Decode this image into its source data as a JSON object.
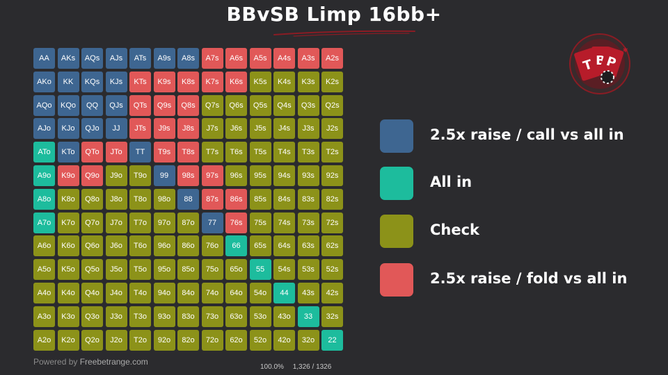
{
  "title": "BBvSB Limp 16bb+",
  "colors": {
    "raise_call": "#3e6691",
    "all_in": "#1dbc9d",
    "check": "#8c9219",
    "raise_fold": "#e15858",
    "background": "#2b2b2e",
    "accent": "#8a1c24"
  },
  "logo": {
    "text": "TBP"
  },
  "ranks": [
    "A",
    "K",
    "Q",
    "J",
    "T",
    "9",
    "8",
    "7",
    "6",
    "5",
    "4",
    "3",
    "2"
  ],
  "matrix": [
    [
      "AA",
      "AKs",
      "AQs",
      "AJs",
      "ATs",
      "A9s",
      "A8s",
      "A7s",
      "A6s",
      "A5s",
      "A4s",
      "A3s",
      "A2s"
    ],
    [
      "AKo",
      "KK",
      "KQs",
      "KJs",
      "KTs",
      "K9s",
      "K8s",
      "K7s",
      "K6s",
      "K5s",
      "K4s",
      "K3s",
      "K2s"
    ],
    [
      "AQo",
      "KQo",
      "QQ",
      "QJs",
      "QTs",
      "Q9s",
      "Q8s",
      "Q7s",
      "Q6s",
      "Q5s",
      "Q4s",
      "Q3s",
      "Q2s"
    ],
    [
      "AJo",
      "KJo",
      "QJo",
      "JJ",
      "JTs",
      "J9s",
      "J8s",
      "J7s",
      "J6s",
      "J5s",
      "J4s",
      "J3s",
      "J2s"
    ],
    [
      "ATo",
      "KTo",
      "QTo",
      "JTo",
      "TT",
      "T9s",
      "T8s",
      "T7s",
      "T6s",
      "T5s",
      "T4s",
      "T3s",
      "T2s"
    ],
    [
      "A9o",
      "K9o",
      "Q9o",
      "J9o",
      "T9o",
      "99",
      "98s",
      "97s",
      "96s",
      "95s",
      "94s",
      "93s",
      "92s"
    ],
    [
      "A8o",
      "K8o",
      "Q8o",
      "J8o",
      "T8o",
      "98o",
      "88",
      "87s",
      "86s",
      "85s",
      "84s",
      "83s",
      "82s"
    ],
    [
      "A7o",
      "K7o",
      "Q7o",
      "J7o",
      "T7o",
      "97o",
      "87o",
      "77",
      "76s",
      "75s",
      "74s",
      "73s",
      "72s"
    ],
    [
      "A6o",
      "K6o",
      "Q6o",
      "J6o",
      "T6o",
      "96o",
      "86o",
      "76o",
      "66",
      "65s",
      "64s",
      "63s",
      "62s"
    ],
    [
      "A5o",
      "K5o",
      "Q5o",
      "J5o",
      "T5o",
      "95o",
      "85o",
      "75o",
      "65o",
      "55",
      "54s",
      "53s",
      "52s"
    ],
    [
      "A4o",
      "K4o",
      "Q4o",
      "J4o",
      "T4o",
      "94o",
      "84o",
      "74o",
      "64o",
      "54o",
      "44",
      "43s",
      "42s"
    ],
    [
      "A3o",
      "K3o",
      "Q3o",
      "J3o",
      "T3o",
      "93o",
      "83o",
      "73o",
      "63o",
      "53o",
      "43o",
      "33",
      "32s"
    ],
    [
      "A2o",
      "K2o",
      "Q2o",
      "J2o",
      "T2o",
      "92o",
      "82o",
      "72o",
      "62o",
      "52o",
      "42o",
      "32o",
      "22"
    ]
  ],
  "actions": [
    "BBBBBBBRRRRRR",
    "BBBBRRRRRCCCC",
    "BBBBRRRCCCCCC",
    "BBBBRRRCCCCCC",
    "ABRRBRRCCCCCC",
    "ARRCCBRRCCCCC",
    "ACCCCCBRRCCCC",
    "ACCCCCCBRCCCC",
    "CCCCCCCCACCCC",
    "CCCCCCCCCACCC",
    "CCCCCCCCCCACC",
    "CCCCCCCCCCCAC",
    "CCCCCCCCCCCCA"
  ],
  "legend": [
    {
      "label": "2.5x raise / call vs all in",
      "color": "#3e6691"
    },
    {
      "label": "All in",
      "color": "#1dbc9d"
    },
    {
      "label": "Check",
      "color": "#8c9219"
    },
    {
      "label": "2.5x raise / fold vs all in",
      "color": "#e15858"
    }
  ],
  "footer": {
    "powered_by": "Powered by",
    "brand": "Freebetrange.com",
    "percent": "100.0%",
    "combos": "1,326 / 1326"
  }
}
